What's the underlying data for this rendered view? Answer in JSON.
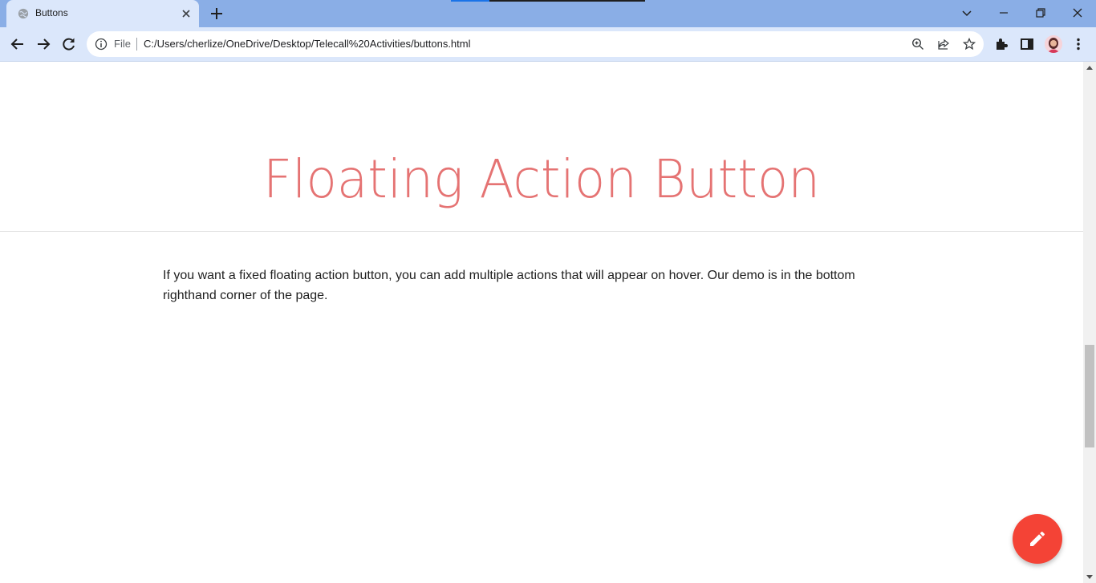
{
  "browser": {
    "tab": {
      "title": "Buttons"
    },
    "address_bar": {
      "scheme_label": "File",
      "url": "C:/Users/cherlize/OneDrive/Desktop/Telecall%20Activities/buttons.html"
    }
  },
  "page": {
    "title": "Floating Action Button",
    "description": "If you want a fixed floating action button, you can add multiple actions that will appear on hover. Our demo is in the bottom righthand corner of the page.",
    "fab_icon": "edit-icon"
  },
  "colors": {
    "title": "#e57373",
    "fab": "#f44336",
    "tabstrip": "#8aaee6",
    "toolbar": "#dbe7fb"
  }
}
